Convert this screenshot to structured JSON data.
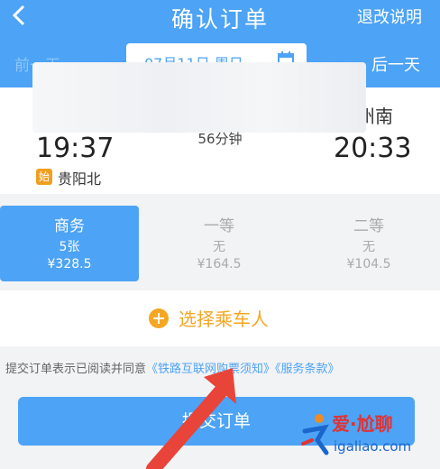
{
  "header": {
    "title": "确认订单",
    "refund_label": "退改说明",
    "prev_day": "前一天",
    "next_day": "后一天",
    "date": "07月11日 周日"
  },
  "train": {
    "arr_station_partial": "州南",
    "dep_time": "19:37",
    "arr_time": "20:33",
    "duration": "56分钟",
    "start_badge": "始",
    "dep_station": "贵阳北"
  },
  "seats": [
    {
      "name": "商务",
      "count": "5张",
      "price": "¥328.5",
      "selected": true
    },
    {
      "name": "一等",
      "count": "无",
      "price": "¥164.5",
      "selected": false
    },
    {
      "name": "二等",
      "count": "无",
      "price": "¥104.5",
      "selected": false
    }
  ],
  "passenger": {
    "label": "选择乘车人"
  },
  "agreement": {
    "prefix": "提交订单表示已阅读并同意",
    "link1": "《铁路互联网购票须知》",
    "link2": "《服务条款》"
  },
  "submit": {
    "label": "提交订单"
  },
  "watermark": {
    "text": "爱·尬聊",
    "url": "igaliao.com"
  },
  "colors": {
    "primary": "#4da3f5",
    "accent": "#f5a623",
    "annotation_arrow": "#e8443a"
  }
}
